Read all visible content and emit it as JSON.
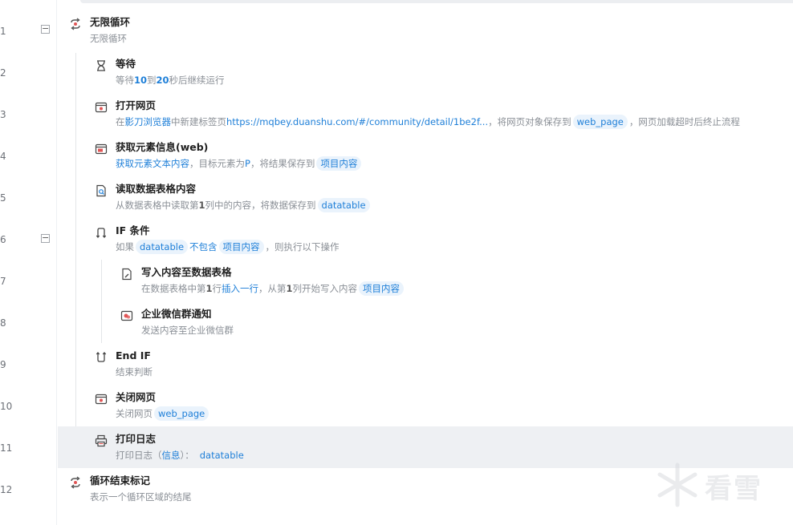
{
  "line_numbers": [
    "1",
    "2",
    "3",
    "4",
    "5",
    "6",
    "7",
    "8",
    "9",
    "10",
    "11",
    "12"
  ],
  "steps": [
    {
      "title": "无限循环",
      "desc": "无限循环"
    },
    {
      "title": "等待",
      "desc": {
        "p1": "等待",
        "n1": "10",
        "p2": "到",
        "n2": "20",
        "p3": "秒后继续运行"
      }
    },
    {
      "title": "打开网页",
      "desc": {
        "p1": "在",
        "browser": "影刀浏览器",
        "p2": "中新建标签页",
        "url": "https://mqbey.duanshu.com/#/community/detail/1be2f...",
        "p3": "，将网页对象保存到",
        "var": "web_page",
        "p4": "，网页加载超时后终止流程"
      }
    },
    {
      "title": "获取元素信息(web)",
      "desc": {
        "action": "获取元素文本内容",
        "p1": "，目标元素为",
        "target": "P",
        "p2": "，将结果保存到",
        "var": "项目内容"
      }
    },
    {
      "title": "读取数据表格内容",
      "desc": {
        "p1": "从数据表格中读取第",
        "num": "1",
        "p2": "列中的内容，将数据保存到",
        "var": "datatable"
      }
    },
    {
      "title": "IF 条件",
      "desc": {
        "p1": "如果",
        "a": "datatable",
        "op": "不包含",
        "b": "项目内容",
        "p2": "，则执行以下操作"
      }
    },
    {
      "title": "写入内容至数据表格",
      "desc": {
        "p1": "在数据表格中第",
        "n1": "1",
        "p2": "行",
        "mode": "插入一行",
        "p3": "，从第",
        "n2": "1",
        "p4": "列开始写入内容",
        "var": "项目内容"
      }
    },
    {
      "title": "企业微信群通知",
      "desc": "发送内容至企业微信群"
    },
    {
      "title": "End IF",
      "desc": "结束判断"
    },
    {
      "title": "关闭网页",
      "desc": {
        "p1": "关闭网页",
        "var": "web_page"
      }
    },
    {
      "title": "打印日志",
      "desc": {
        "p1": "打印日志（",
        "level": "信息",
        "p2": "）：",
        "var": "datatable"
      }
    },
    {
      "title": "循环结束标记",
      "desc": "表示一个循环区域的结尾"
    }
  ],
  "collapse_symbol": "−",
  "watermark": {
    "text": "看雪",
    "icon": "snowflake-icon"
  },
  "colors": {
    "accent": "#1e7fd8",
    "tag_bg": "#eaf3fc",
    "highlight_row": "#eef0f3"
  }
}
